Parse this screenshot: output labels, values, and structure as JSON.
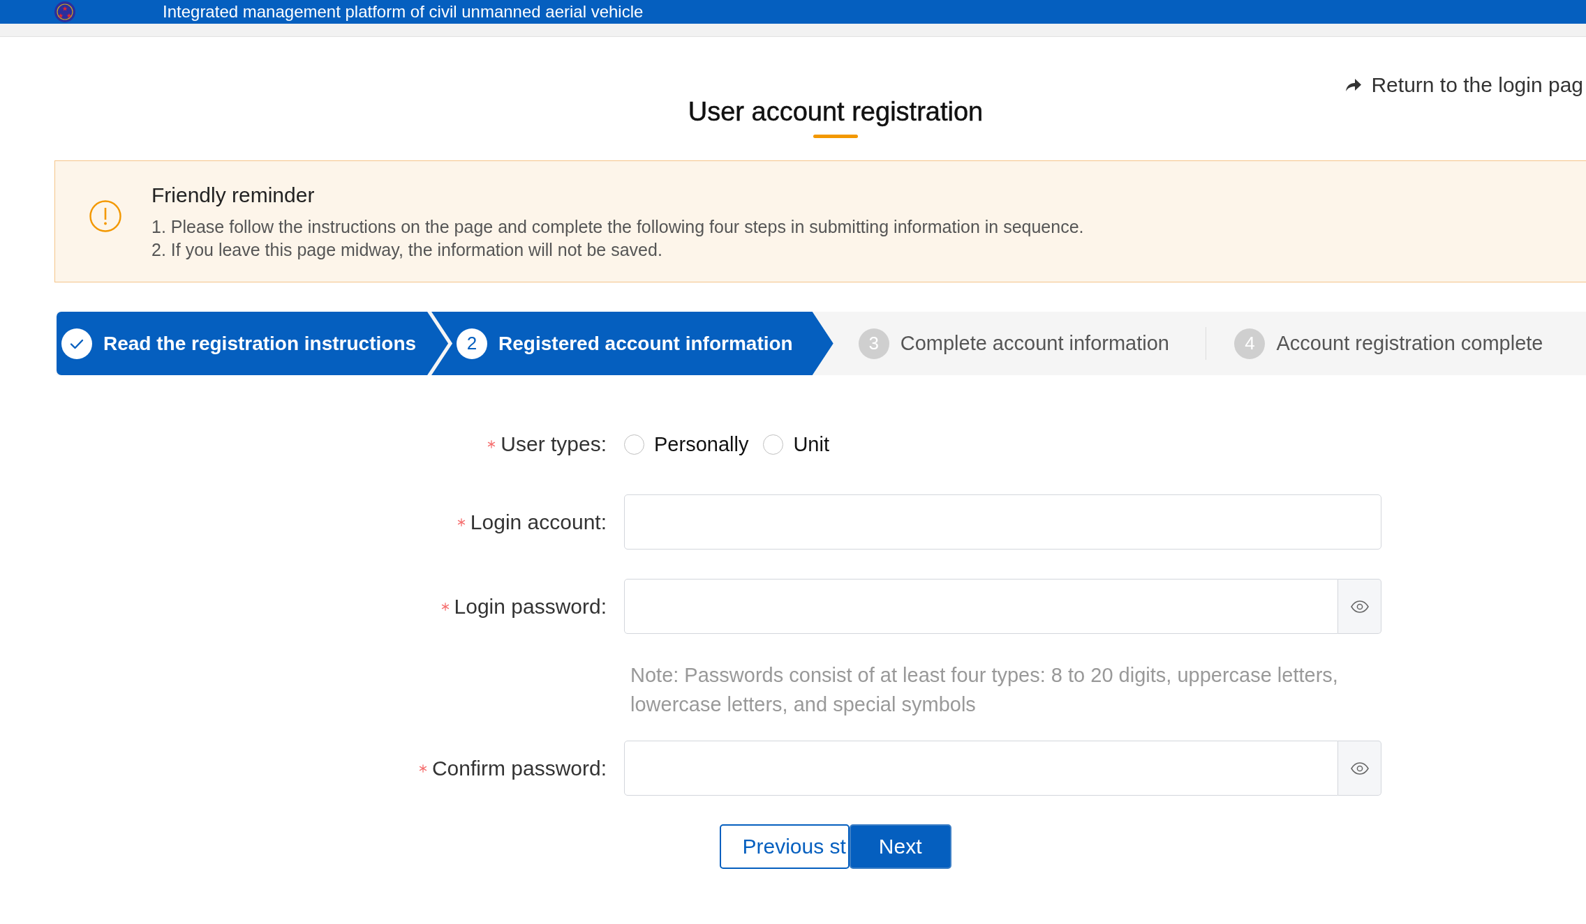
{
  "header": {
    "platform_name": "Integrated management platform of civil unmanned aerial vehicle"
  },
  "page": {
    "title": "User account registration",
    "return_link": "Return to the login pag"
  },
  "reminder": {
    "title": "Friendly reminder",
    "lines": [
      "1. Please follow the instructions on the page and complete the following four steps in submitting information in sequence.",
      "2. If you leave this page midway, the information will not be saved."
    ]
  },
  "steps": [
    {
      "label": "Read the registration instructions",
      "done": true,
      "active": false
    },
    {
      "number": "2",
      "label": "Registered account information",
      "done": false,
      "active": true
    },
    {
      "number": "3",
      "label": "Complete account information",
      "done": false,
      "active": false
    },
    {
      "number": "4",
      "label": "Account registration complete",
      "done": false,
      "active": false
    }
  ],
  "form": {
    "fields": [
      {
        "kind": "radio",
        "label": "User types:",
        "required": true,
        "options": [
          {
            "label": "Personally",
            "selected": false
          },
          {
            "label": "Unit",
            "selected": false
          }
        ]
      },
      {
        "kind": "text",
        "label": "Login account:",
        "required": true
      },
      {
        "kind": "password",
        "label": "Login password:",
        "required": true,
        "note": "Note: Passwords consist of at least four types: 8 to 20 digits, uppercase letters, lowercase letters, and special symbols"
      },
      {
        "kind": "password",
        "label": "Confirm password:",
        "required": true
      }
    ]
  },
  "buttons": [
    {
      "label": "Previous st",
      "kind": "secondary"
    },
    {
      "label": "Next",
      "kind": "primary"
    }
  ]
}
